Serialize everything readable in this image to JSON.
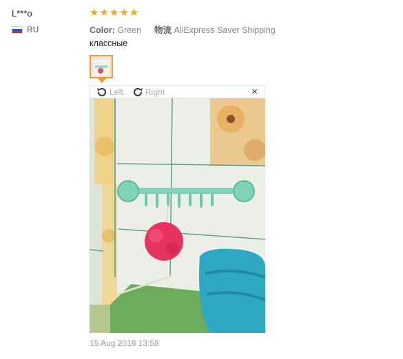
{
  "reviewer": {
    "name": "L***o",
    "country": "RU"
  },
  "rating": {
    "stars": 5,
    "max": 5
  },
  "meta": {
    "color_label": "Color:",
    "color_value": "Green",
    "shipping_label": "物流",
    "shipping_value": "AliExpress Saver Shipping"
  },
  "comment": "классные",
  "viewer": {
    "left_label": "Left",
    "right_label": "Right",
    "close_glyph": "×"
  },
  "date": "15 Aug 2018 13:58",
  "colors": {
    "star": "#f5a623",
    "thumb_border": "#f29a38",
    "accent_teal": "#5ec9b0"
  }
}
